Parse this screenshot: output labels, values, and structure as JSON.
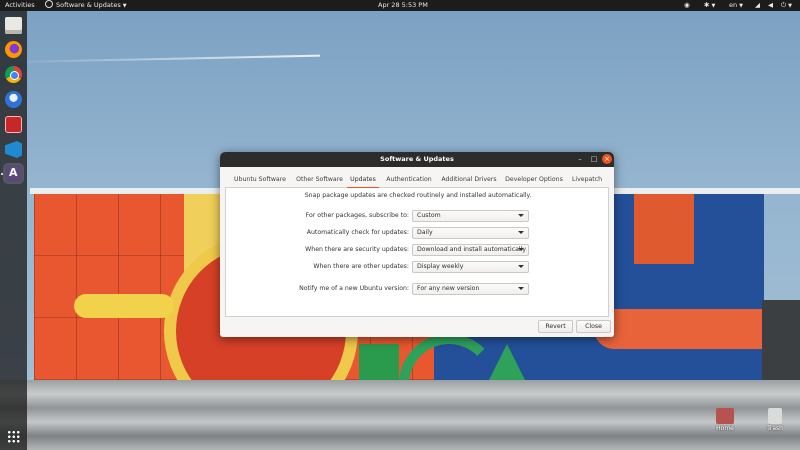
{
  "topbar": {
    "activities": "Activities",
    "app_name": "Software & Updates",
    "clock": "Apr 28   5:53 PM",
    "lang": "en"
  },
  "dialog": {
    "title": "Software & Updates",
    "tabs": [
      {
        "label": "Ubuntu Software"
      },
      {
        "label": "Other Software"
      },
      {
        "label": "Updates"
      },
      {
        "label": "Authentication"
      },
      {
        "label": "Additional Drivers"
      },
      {
        "label": "Developer Options"
      },
      {
        "label": "Livepatch"
      }
    ],
    "active_tab": "Updates",
    "intro": "Snap package updates are checked routinely and installed automatically.",
    "rows": [
      {
        "label": "For other packages, subscribe to:",
        "value": "Custom"
      },
      {
        "label": "Automatically check for updates:",
        "value": "Daily"
      },
      {
        "label": "When there are security updates:",
        "value": "Download and install automatically"
      },
      {
        "label": "When there are other updates:",
        "value": "Display weekly"
      },
      {
        "label": "Notify me of a new Ubuntu version:",
        "value": "For any new version"
      }
    ],
    "buttons": {
      "revert": "Revert",
      "close": "Close"
    }
  },
  "desktop_icons": {
    "home": "Home",
    "trash": "Trash"
  },
  "colors": {
    "accent": "#e95420",
    "titlebar": "#2c2c2c",
    "topbar": "#1c1c1c"
  },
  "icons": {
    "dock": [
      "files-icon",
      "firefox-icon",
      "chrome-icon",
      "thunderbird-icon",
      "red-app-icon",
      "vscode-icon",
      "software-updater-icon",
      "show-apps-icon"
    ]
  }
}
